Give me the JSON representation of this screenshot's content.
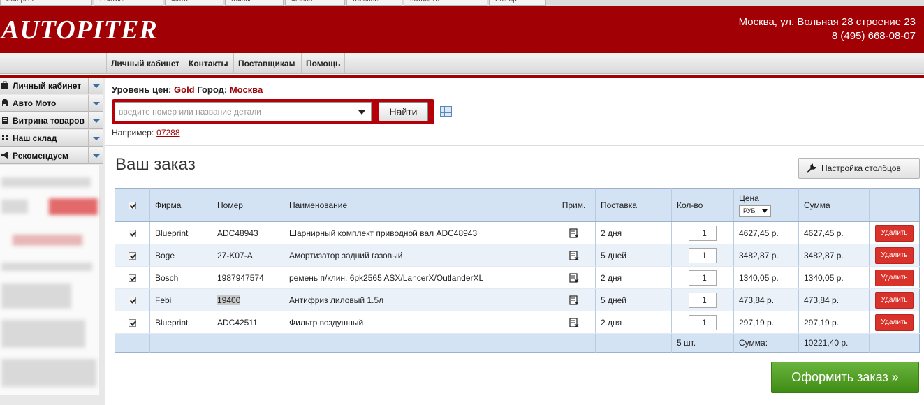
{
  "browser_tabs": [
    "Autopiter",
    "Рейтинг",
    "Мото",
    "Шины",
    "Масла",
    "Шинное",
    "Каталоги",
    "Выбор"
  ],
  "header": {
    "logo": "AUTOPITER",
    "address": "Москва, ул. Вольная 28 строение 23",
    "phone": "8 (495) 668-08-07"
  },
  "topnav": [
    "Личный кабинет",
    "Контакты",
    "Поставщикам",
    "Помощь"
  ],
  "sidebar": {
    "items": [
      {
        "label": "Личный кабинет",
        "icon": "briefcase-icon"
      },
      {
        "label": "Авто Мото",
        "icon": "car-icon"
      },
      {
        "label": "Витрина товаров",
        "icon": "showcase-icon"
      },
      {
        "label": "Наш склад",
        "icon": "warehouse-icon"
      },
      {
        "label": "Рекомендуем",
        "icon": "megaphone-icon"
      }
    ]
  },
  "search": {
    "price_level_label": "Уровень цен:",
    "price_level_value": "Gold",
    "city_label": "Город:",
    "city_value": "Москва",
    "placeholder": "введите номер или название детали",
    "button": "Найти",
    "example_label": "Например:",
    "example_value": "07288"
  },
  "order": {
    "title": "Ваш заказ",
    "columns_button": "Настройка столбцов",
    "headers": {
      "firm": "Фирма",
      "number": "Номер",
      "name": "Наименование",
      "note": "Прим.",
      "delivery": "Поставка",
      "qty": "Кол-во",
      "price": "Цена",
      "currency": "РУБ",
      "sum": "Сумма"
    },
    "rows": [
      {
        "firm": "Blueprint",
        "number": "ADC48943",
        "name": "Шарнирный комплект приводной вал ADC48943",
        "delivery": "2 дня",
        "qty": "1",
        "price": "4627,45 р.",
        "sum": "4627,45 р.",
        "delete": "Удалить"
      },
      {
        "firm": "Boge",
        "number": "27-K07-A",
        "name": "Амортизатор задний газовый",
        "delivery": "5 дней",
        "qty": "1",
        "price": "3482,87 р.",
        "sum": "3482,87 р.",
        "delete": "Удалить"
      },
      {
        "firm": "Bosch",
        "number": "1987947574",
        "name": "ремень п/клин. 6pk2565 ASX/LancerX/OutlanderXL",
        "delivery": "2 дня",
        "qty": "1",
        "price": "1340,05 р.",
        "sum": "1340,05 р.",
        "delete": "Удалить"
      },
      {
        "firm": "Febi",
        "number": "19400",
        "name": "Антифриз лиловый 1.5л",
        "delivery": "5 дней",
        "qty": "1",
        "price": "473,84 р.",
        "sum": "473,84 р.",
        "delete": "Удалить"
      },
      {
        "firm": "Blueprint",
        "number": "ADC42511",
        "name": "Фильтр воздушный",
        "delivery": "2 дня",
        "qty": "1",
        "price": "297,19 р.",
        "sum": "297,19 р.",
        "delete": "Удалить"
      }
    ],
    "total": {
      "count": "5 шт.",
      "sum_label": "Сумма:",
      "sum_value": "10221,40 р."
    },
    "checkout_button": "Оформить заказ »"
  },
  "colors": {
    "brand_red": "#a10005",
    "header_blue": "#d4e3f3",
    "delete_red": "#d8322b",
    "checkout_green": "#4f9c22"
  }
}
